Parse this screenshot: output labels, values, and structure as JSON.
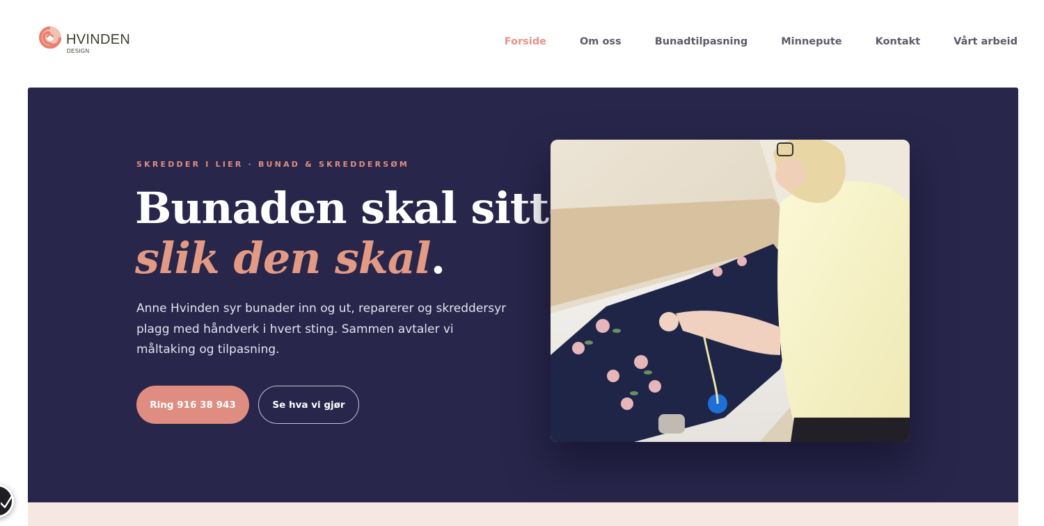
{
  "brand": {
    "name": "HVINDEN",
    "sub": "DESIGN",
    "colors": {
      "accent": "#e8908a",
      "hero_bg": "#28264a",
      "button": "#df8d80",
      "strip_bg": "#f6e7e3"
    }
  },
  "nav": {
    "items": [
      {
        "label": "Forside",
        "active": true
      },
      {
        "label": "Om oss"
      },
      {
        "label": "Bunadtilpasning"
      },
      {
        "label": "Minnepute"
      },
      {
        "label": "Kontakt"
      },
      {
        "label": "Vårt arbeid"
      }
    ]
  },
  "hero": {
    "eyebrow": "SKREDDER I LIER · BUNAD & SKREDDERSØM",
    "headline_line1": "Bunaden skal sitte",
    "headline_accent": "slik den skal",
    "headline_period": ".",
    "lead": "Anne Hvinden syr bunader inn og ut, reparerer og skreddersyr plagg med håndverk i hvert sting. Sammen avtaler vi måltaking og tilpasning.",
    "primary_cta": "Ring 916 38 943",
    "secondary_cta": "Se hva vi gjør",
    "photo_icon": "tailor-photo"
  },
  "badge": {
    "icon": "checkmark-circle-icon"
  }
}
